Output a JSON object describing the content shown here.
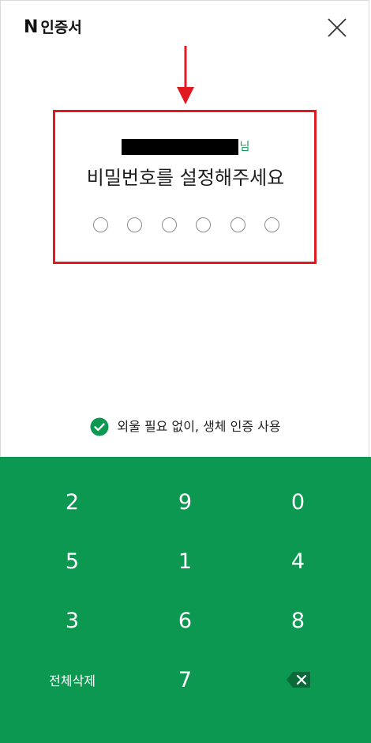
{
  "header": {
    "logo_letter": "N",
    "title": "인증서",
    "close_icon": "close-icon"
  },
  "content": {
    "user_suffix": "님",
    "prompt": "비밀번호를 설정해주세요",
    "pin_length": 6,
    "pin_filled": 0
  },
  "biometric": {
    "label": "외울 필요 없이, 생체 인증 사용",
    "checked": true
  },
  "keypad": {
    "keys": [
      "2",
      "9",
      "0",
      "5",
      "1",
      "4",
      "3",
      "6",
      "8"
    ],
    "clear_label": "전체삭제",
    "last_digit": "7",
    "delete_icon": "backspace-icon"
  },
  "colors": {
    "accent": "#0d9852",
    "highlight_border": "#e11a22"
  }
}
